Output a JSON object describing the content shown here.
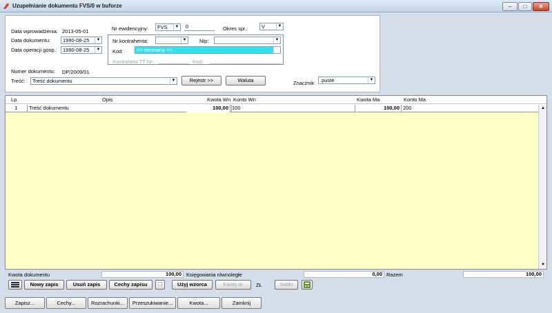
{
  "window": {
    "title": "Uzupełnianie dokumentu FVS/0 w buforze",
    "minimize": "–",
    "maximize": "□",
    "close": "✕"
  },
  "header": {
    "data_wprowadzenia_label": "Data wprowadzenia:",
    "data_wprowadzenia_value": "2013-05-01",
    "data_dokumentu_label": "Data dokumentu:",
    "data_dokumentu_value": "1990-08-25",
    "data_operacji_label": "Data operacji gosp.:",
    "data_operacji_value": "1990-08-25",
    "numer_dokumentu_label": "Numer dokumentu:",
    "numer_dokumentu_value": "DP/2009/01",
    "tresc_label": "Treść:",
    "tresc_value": "Treść dokumentu",
    "nr_ewid_label": "Nr ewidencyjny:",
    "nr_ewid_combo": "FVS",
    "nr_ewid_value": "0",
    "okres_label": "Okres spr.:",
    "okres_value": "V",
    "nr_kontrahenta_label": "Nr kontrahenta:",
    "nr_kontrahenta_value": "",
    "nip_label": "Nip:",
    "nip_value": "",
    "kod_label": "Kod:",
    "kod_value": "== nieznany ==",
    "kontrahent_tt_label": "Kontrahent TT Nr:",
    "kod2_label": "Kod:",
    "rejestr_button": "Rejestr >>",
    "waluta_button": "Waluta",
    "znacznik_label": "Znacznik:",
    "znacznik_value": ".puste"
  },
  "grid": {
    "columns": [
      "Lp.",
      "Opis",
      "Kwota Wn",
      "Konto Wn",
      "Kwota Ma",
      "Konto Ma"
    ],
    "rows": [
      {
        "lp": "1",
        "opis": "Treść dokumentu",
        "kwota_wn": "100,00",
        "konto_wn": "100",
        "kwota_ma": "100,00",
        "konto_ma": "200"
      }
    ]
  },
  "summary": {
    "kwota_dokumentu_label": "Kwota dokumentu",
    "kwota_dokumentu_value": "100,00",
    "ksiegowania_label": "Księgowania równoległe",
    "ksiegowania_value": "0,00",
    "razem_label": "Razem",
    "razem_value": "100,00"
  },
  "toolbar": {
    "nowy_zapis": "Nowy zapis",
    "usun_zapis": "Usuń zapis",
    "cechy_zapisu": "Cechy zapisu",
    "uzyj_wzorca": "Użyj wzorca",
    "kwoty_w": "Kwoty w.",
    "zl": "ZŁ",
    "saldo": "Saldo"
  },
  "bottom_tabs": [
    "Zapisz...",
    "Cechy...",
    "Rozrachunki...",
    "Przeszukiwanie...",
    "Kwota...",
    "Zamknij"
  ],
  "colors": {
    "grid_background": "#ffffc8",
    "kod_highlight": "#33e0f0",
    "title_bar": "#c5d5ea"
  }
}
